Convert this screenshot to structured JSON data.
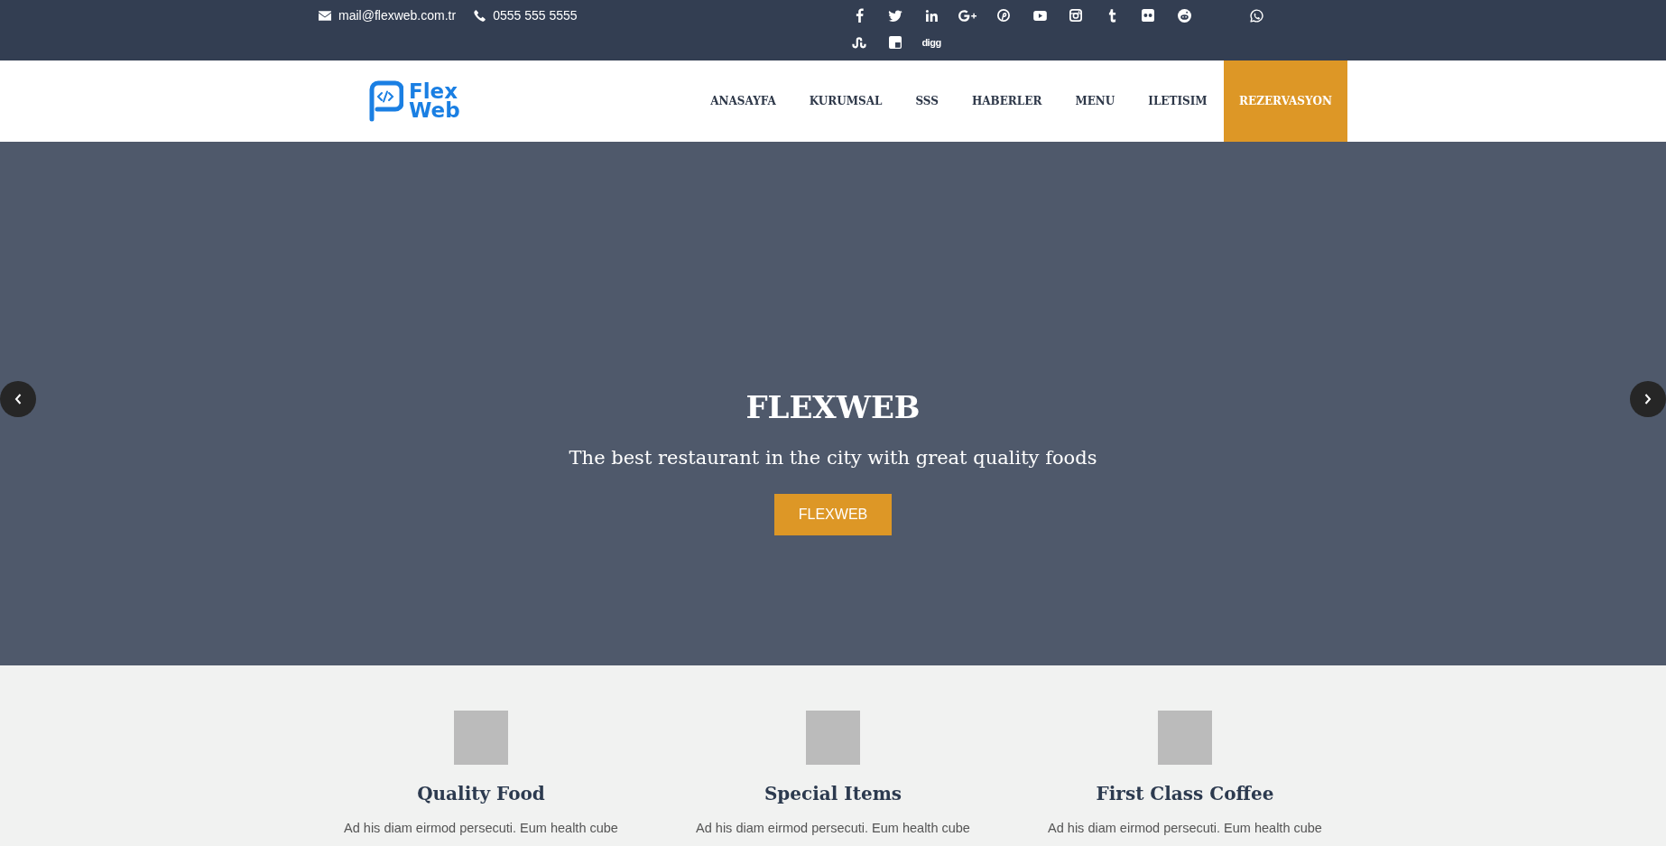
{
  "top_bar": {
    "email": "mail@flexweb.com.tr",
    "phone": "0555 555 5555",
    "social_links": [
      {
        "kind": "facebook"
      },
      {
        "kind": "twitter"
      },
      {
        "kind": "linkedin"
      },
      {
        "kind": "googleplus"
      },
      {
        "kind": "pinterest"
      },
      {
        "kind": "youtube"
      },
      {
        "kind": "instagram"
      },
      {
        "kind": "tumblr"
      },
      {
        "kind": "flickr"
      },
      {
        "kind": "reddit"
      },
      {
        "kind": "whatsapp"
      },
      {
        "kind": "stumbleupon"
      },
      {
        "kind": "delicious"
      },
      {
        "kind": "digg",
        "label": "digg"
      }
    ]
  },
  "header": {
    "logo": {
      "lines": [
        "Flex",
        "Web"
      ]
    },
    "nav": [
      {
        "label": "ANASAYFA",
        "highlighted": false
      },
      {
        "label": "KURUMSAL",
        "highlighted": false
      },
      {
        "label": "SSS",
        "highlighted": false
      },
      {
        "label": "HABERLER",
        "highlighted": false
      },
      {
        "label": "MENU",
        "highlighted": false
      },
      {
        "label": "ILETISIM",
        "highlighted": false
      },
      {
        "label": "REZERVASYON",
        "highlighted": true
      }
    ]
  },
  "hero": {
    "title": "FLEXWEB",
    "subtitle": "The best restaurant in the city with great quality foods",
    "button": "FLEXWEB"
  },
  "features": [
    {
      "title": "Quality Food",
      "text": "Ad his diam eirmod persecuti. Eum health cube"
    },
    {
      "title": "Special Items",
      "text": "Ad his diam eirmod persecuti. Eum health cube"
    },
    {
      "title": "First Class Coffee",
      "text": "Ad his diam eirmod persecuti. Eum health cube"
    }
  ]
}
